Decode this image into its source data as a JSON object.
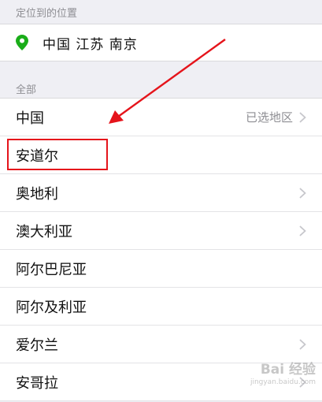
{
  "location_section": {
    "header": "定位到的位置",
    "current_location": "中国 江苏 南京",
    "icon": "map-pin-icon"
  },
  "all_section": {
    "header": "全部",
    "items": [
      {
        "label": "中国",
        "detail": "已选地区",
        "chevron": true
      },
      {
        "label": "安道尔",
        "detail": "",
        "chevron": false
      },
      {
        "label": "奥地利",
        "detail": "",
        "chevron": true
      },
      {
        "label": "澳大利亚",
        "detail": "",
        "chevron": true
      },
      {
        "label": "阿尔巴尼亚",
        "detail": "",
        "chevron": false
      },
      {
        "label": "阿尔及利亚",
        "detail": "",
        "chevron": false
      },
      {
        "label": "爱尔兰",
        "detail": "",
        "chevron": true
      },
      {
        "label": "安哥拉",
        "detail": "",
        "chevron": true
      }
    ]
  },
  "annotation": {
    "highlight_color": "#e5141b",
    "highlighted_item": "安道尔"
  },
  "watermark": {
    "logo": "Bai 经验",
    "url": "jingyan.baidu.com"
  },
  "colors": {
    "background": "#efeff4",
    "pin": "#1aad19",
    "secondary_text": "#8e8e93"
  }
}
